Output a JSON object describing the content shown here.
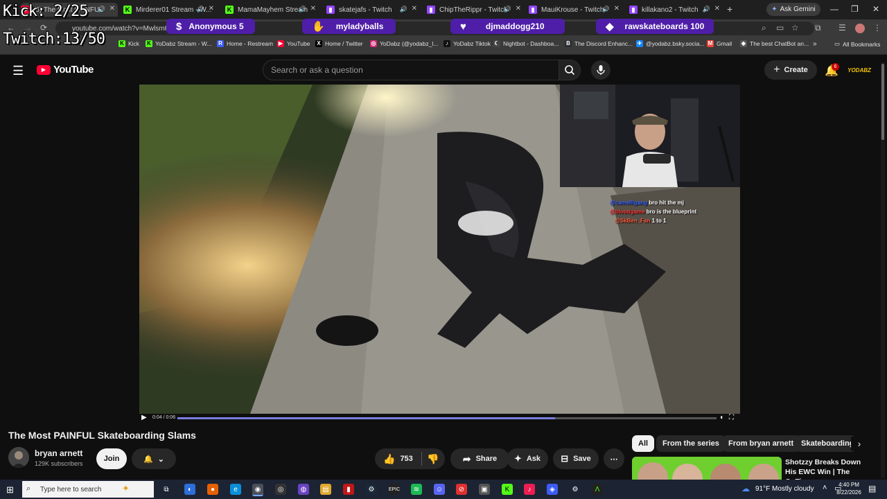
{
  "overlay": {
    "kick_counter": "Kick: 2/25",
    "twitch_counter": "Twitch:13/50",
    "alerts": [
      {
        "icon": "dollar-icon",
        "text": "Anonymous 5"
      },
      {
        "icon": "hand-icon",
        "text": "myladyballs"
      },
      {
        "icon": "heart-icon",
        "text": "djmaddogg210"
      },
      {
        "icon": "diamond-icon",
        "text": "rawskateboards 100"
      }
    ]
  },
  "browser": {
    "tabs": [
      {
        "label": "(6) The Most PAINFUL",
        "active": true
      },
      {
        "label": "Mirderer01 Stream - W..."
      },
      {
        "label": "MamaMayhem Stream"
      },
      {
        "label": "skatejafs - Twitch"
      },
      {
        "label": "ChipTheRippr - Twitch"
      },
      {
        "label": "MauiKrouse - Twitch"
      },
      {
        "label": "killakano2 - Twitch"
      }
    ],
    "ask_gemini": "Ask Gemini",
    "url": "youtube.com/watch?v=MwlsmH...",
    "bookmarks": [
      "Kick",
      "YoDabz Stream - W...",
      "Home - Restream",
      "YouTube",
      "Home / Twitter",
      "YoDabz (@yodabz_l...",
      "YoDabz Tiktok",
      "Nightbot - Dashboa...",
      "The Discord Enhanc...",
      "@yodabz.bsky.socia...",
      "Gmail",
      "The best ChatBot an..."
    ],
    "all_bookmarks": "All Bookmarks",
    "colors": {
      "tab_bg": "#1f1f1f",
      "toolbar_bg": "#3a3a3a",
      "alert_purple": "#4e1ea8"
    }
  },
  "youtube": {
    "logo_text": "YouTube",
    "search_placeholder": "Search or ask a question",
    "create_label": "Create",
    "notification_count": "6",
    "avatar_text": "YODABZ",
    "player": {
      "time": "0:04 / 0:06",
      "progress": 0.7
    },
    "chat_overlay": [
      {
        "user": "@camelligang",
        "message": "bro hit the mj",
        "color": "#3a64ff"
      },
      {
        "user": "@bloodgame",
        "message": "bro is the blueprint",
        "color": "#ff3a3a"
      },
      {
        "user": "@SkBen_Fan",
        "message": "1 to 1",
        "color": "#ff5a3a"
      }
    ],
    "video_title": "The Most PAINFUL Skateboarding Slams",
    "channel_name": "bryan arnett",
    "subscribers": "129K subscribers",
    "join_label": "Join",
    "like_count": "753",
    "share_label": "Share",
    "ask_label": "Ask",
    "save_label": "Save",
    "chips": [
      "All",
      "From the series",
      "From bryan arnett",
      "Skateboarding"
    ],
    "recommendation_title": "Shotzzy Breaks Down His EWC Win | The OpTic"
  },
  "taskbar": {
    "search_placeholder": "Type here to search",
    "weather": "91°F  Mostly cloudy",
    "time": "4:40 PM",
    "date": "8/22/2026"
  }
}
